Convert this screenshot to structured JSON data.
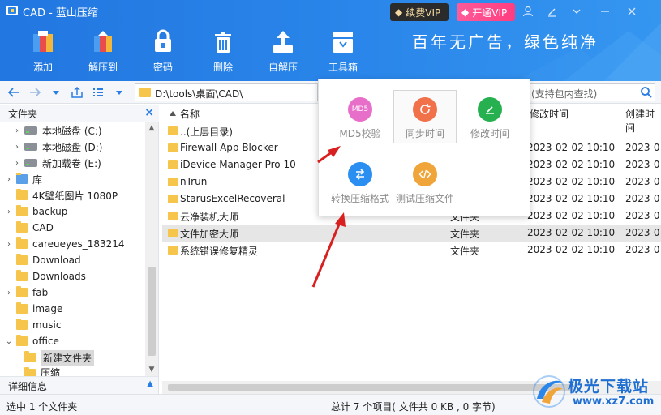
{
  "app": {
    "title": "CAD - 蓝山压缩"
  },
  "vip": {
    "renew": "续费VIP",
    "open": "开通VIP"
  },
  "toolbar": {
    "add": "添加",
    "extract": "解压到",
    "password": "密码",
    "delete": "删除",
    "self_extract": "自解压",
    "toolbox": "工具箱"
  },
  "slogan": "百年无广告，绿色纯净",
  "address": {
    "path": "D:\\tools\\桌面\\CAD\\",
    "search_placeholder": "(支持包内查找)"
  },
  "tree": {
    "header": "文件夹",
    "items": [
      {
        "label": "本地磁盘 (C:)"
      },
      {
        "label": "本地磁盘 (D:)"
      },
      {
        "label": "新加载卷 (E:)"
      },
      {
        "label": "库"
      },
      {
        "label": "4K壁纸图片 1080P"
      },
      {
        "label": "backup"
      },
      {
        "label": "CAD"
      },
      {
        "label": "careueyes_183214"
      },
      {
        "label": "Download"
      },
      {
        "label": "Downloads"
      },
      {
        "label": "fab"
      },
      {
        "label": "image"
      },
      {
        "label": "music"
      },
      {
        "label": "office"
      },
      {
        "label": "新建文件夹"
      },
      {
        "label": "压缩"
      }
    ],
    "detail": "详细信息"
  },
  "list": {
    "col_name": "名称",
    "col_modified": "修改时间",
    "col_created": "创建时间",
    "rows": [
      {
        "name": "..(上层目录)",
        "type": "",
        "modified": "",
        "created": ""
      },
      {
        "name": "Firewall App Blocker",
        "type": "",
        "modified": "2023-02-02 10:10",
        "created": "2023-0"
      },
      {
        "name": "iDevice Manager Pro 10",
        "type": "",
        "modified": "2023-02-02 10:10",
        "created": "2023-0"
      },
      {
        "name": "nTrun",
        "type": "",
        "modified": "2023-02-02 10:10",
        "created": "2023-0"
      },
      {
        "name": "StarusExcelRecoveral",
        "type": "",
        "modified": "2023-02-02 10:10",
        "created": "2023-0"
      },
      {
        "name": "云净装机大师",
        "type": "文件夹",
        "modified": "2023-02-02 10:10",
        "created": "2023-0"
      },
      {
        "name": "文件加密大师",
        "type": "文件夹",
        "modified": "2023-02-02 10:10",
        "created": "2023-0"
      },
      {
        "name": "系统错误修复精灵",
        "type": "文件夹",
        "modified": "2023-02-02 10:10",
        "created": "2023-0"
      }
    ]
  },
  "popup": {
    "md5": "MD5校验",
    "md5_icon_text": "MD5",
    "sync": "同步时间",
    "modify": "修改时间",
    "convert": "转换压缩格式",
    "test": "测试压缩文件"
  },
  "status": {
    "left": "选中 1 个文件夹",
    "center": "总计 7 个项目( 文件共 0 KB , 0 字节)"
  },
  "watermark": {
    "name": "极光下载站",
    "url": "www.xz7.com"
  },
  "colors": {
    "header": "#2a86ea",
    "accent": "#2a7de2",
    "folder": "#f6c64c",
    "arrow": "#d92020"
  }
}
